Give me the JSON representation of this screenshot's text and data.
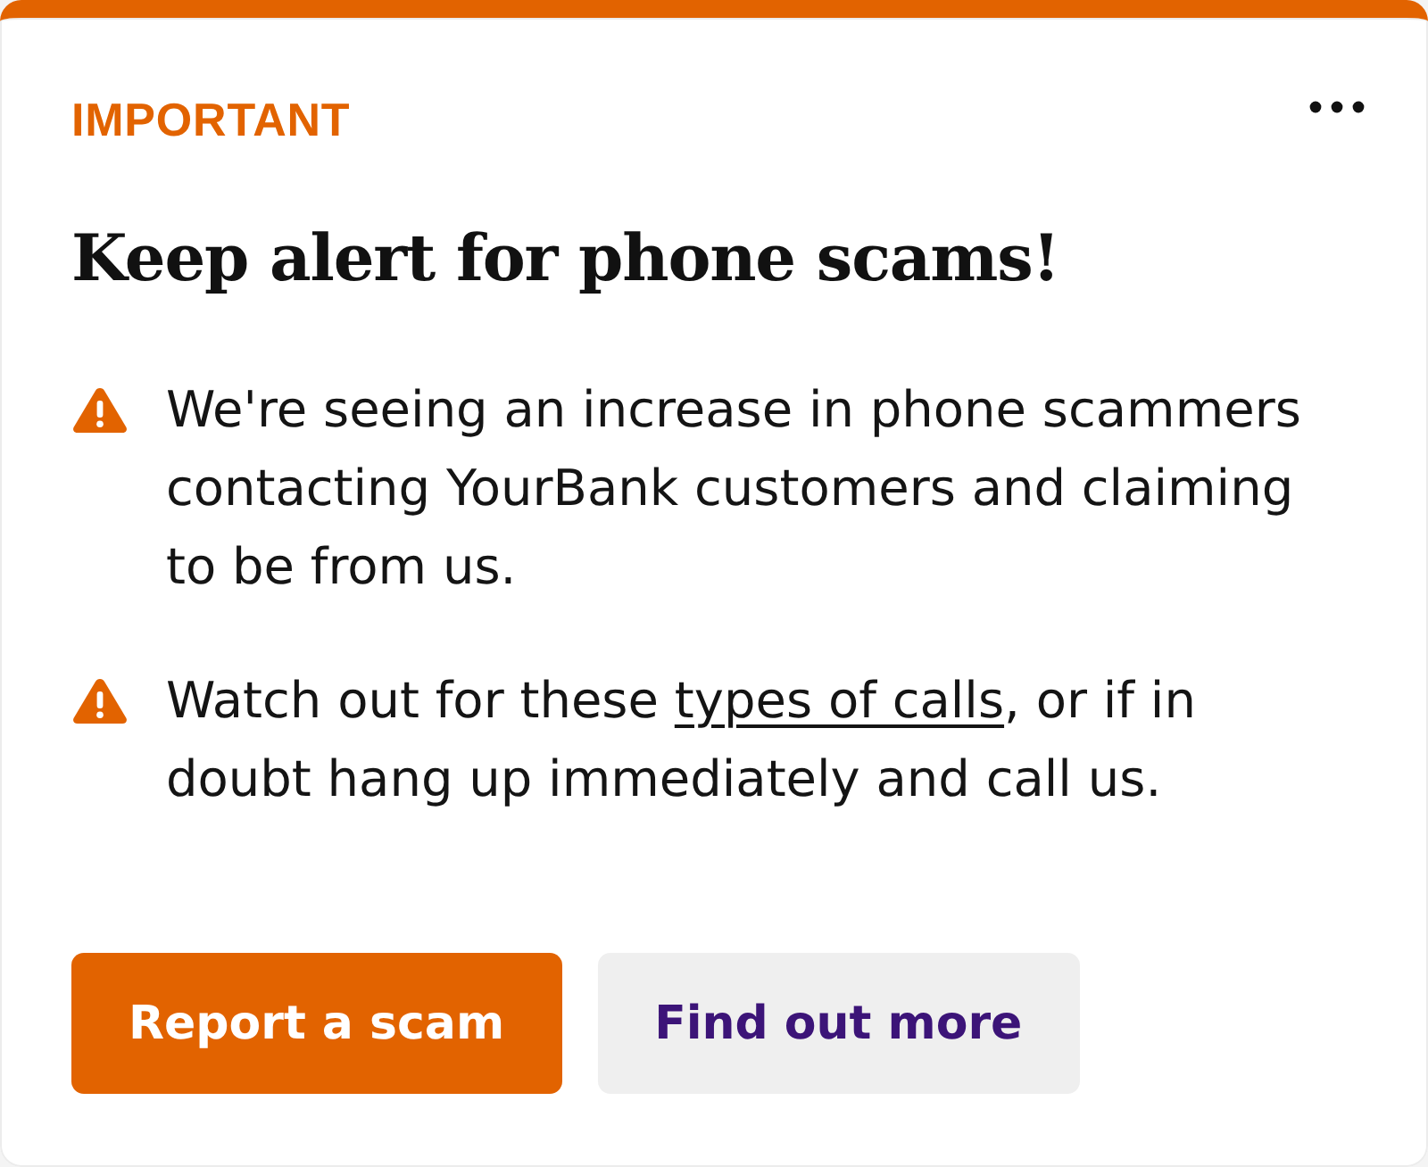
{
  "label": "IMPORTANT",
  "title": "Keep alert for phone scams!",
  "bullets": [
    {
      "kind": "warning",
      "segments": [
        {
          "kind": "text",
          "text": "We're seeing an increase in phone scammers contacting YourBank customers and claiming to be from us."
        }
      ]
    },
    {
      "kind": "warning",
      "segments": [
        {
          "kind": "text",
          "text": "Watch out for these "
        },
        {
          "kind": "link",
          "text": "types of calls"
        },
        {
          "kind": "text",
          "text": ", or if in doubt hang up immediately and call us."
        }
      ]
    }
  ],
  "buttons": [
    {
      "label": "Report a scam",
      "kind": "primary"
    },
    {
      "label": "Find out more",
      "kind": "secondary"
    }
  ]
}
